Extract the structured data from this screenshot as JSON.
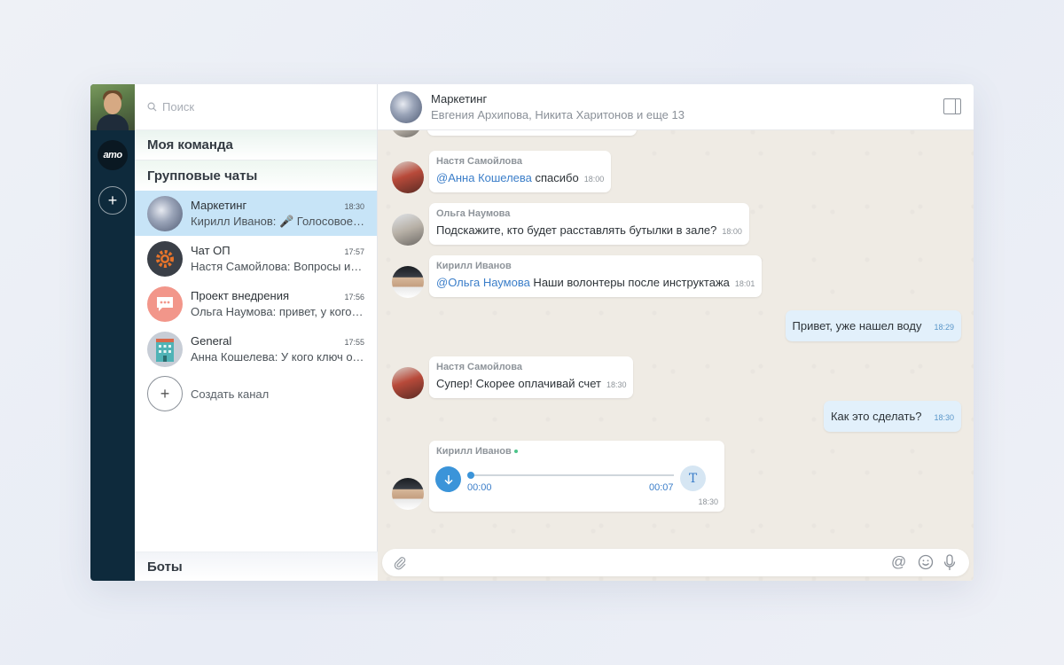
{
  "rail": {
    "brand_logo_text": "amo",
    "add_label": "+"
  },
  "sidebar": {
    "search_placeholder": "Поиск",
    "section_team": "Моя команда",
    "section_groups": "Групповые чаты",
    "chats": [
      {
        "name": "Маркетинг",
        "time": "18:30",
        "preview": "Кирилл Иванов: 🎤 Голосовое сообщение",
        "active": true
      },
      {
        "name": "Чат ОП",
        "time": "17:57",
        "preview": "Настя Самойлова: Вопросы и ответы"
      },
      {
        "name": "Проект внедрения",
        "time": "17:56",
        "preview": "Ольга Наумова: привет, у кого ключ"
      },
      {
        "name": "General",
        "time": "17:55",
        "preview": "Анна Кошелева: У кого ключ от офиса"
      }
    ],
    "create_channel": "Создать канал",
    "section_bots": "Боты"
  },
  "header": {
    "title": "Маркетинг",
    "subtitle": "Евгения Архипова, Никита Харитонов и еще 13"
  },
  "messages": [
    {
      "sender": "Настя Самойлова",
      "mention": "@Анна Кошелева",
      "text": " спасибо",
      "time": "18:00"
    },
    {
      "sender": "Ольга Наумова",
      "mention": "",
      "text": "Подскажите, кто будет расставлять бутылки в зале?",
      "time": "18:00"
    },
    {
      "sender": "Кирилл Иванов",
      "mention": "@Ольга Наумова",
      "text": " Наши волонтеры после инструктажа",
      "time": "18:01"
    },
    {
      "sender": "",
      "mention": "",
      "text": "Привет, уже нашел воду",
      "time": "18:29",
      "outgoing": true
    },
    {
      "sender": "Настя Самойлова",
      "mention": "",
      "text": "Супер! Скорее оплачивай счет",
      "time": "18:30"
    },
    {
      "sender": "",
      "mention": "",
      "text": "Как это сделать?",
      "time": "18:30",
      "outgoing": true
    }
  ],
  "voice_message": {
    "sender": "Кирилл Иванов",
    "current": "00:00",
    "duration": "00:07",
    "time": "18:30",
    "progress": 0,
    "transcribe_label": "T"
  },
  "colors": {
    "rail": "#0e2a3c",
    "accent": "#3b94d9",
    "active_chat": "#c7e4f7",
    "chat_bg": "#efebe4",
    "outgoing_bubble": "#e2f0fb"
  }
}
